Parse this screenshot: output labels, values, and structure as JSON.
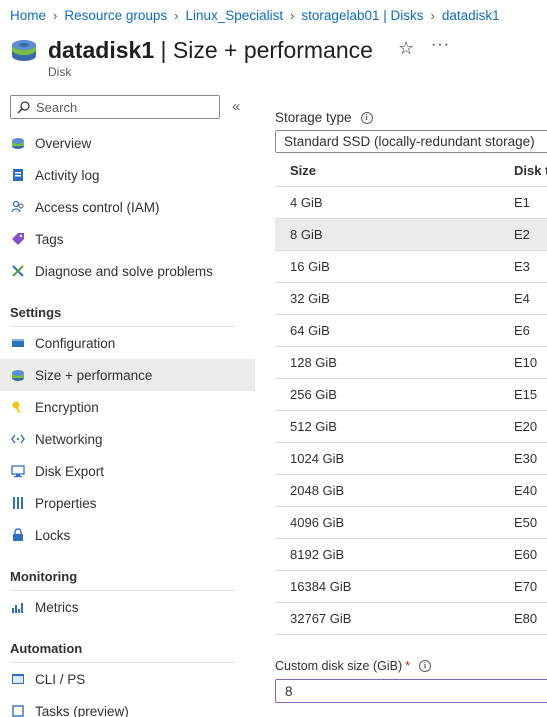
{
  "breadcrumb": [
    "Home",
    "Resource groups",
    "Linux_Specialist",
    "storagelab01 | Disks",
    "datadisk1"
  ],
  "header": {
    "title_bold": "datadisk1",
    "title_rest": " | Size + performance",
    "subtitle": "Disk"
  },
  "sidebar": {
    "search_placeholder": "Search",
    "items_top": [
      {
        "label": "Overview",
        "icon": "overview-icon"
      },
      {
        "label": "Activity log",
        "icon": "activity-log-icon"
      },
      {
        "label": "Access control (IAM)",
        "icon": "iam-icon"
      },
      {
        "label": "Tags",
        "icon": "tag-icon"
      },
      {
        "label": "Diagnose and solve problems",
        "icon": "wrench-icon"
      }
    ],
    "sections": [
      {
        "title": "Settings",
        "items": [
          {
            "label": "Configuration",
            "icon": "configuration-icon"
          },
          {
            "label": "Size + performance",
            "icon": "disk-icon",
            "active": true
          },
          {
            "label": "Encryption",
            "icon": "key-icon"
          },
          {
            "label": "Networking",
            "icon": "networking-icon"
          },
          {
            "label": "Disk Export",
            "icon": "export-icon"
          },
          {
            "label": "Properties",
            "icon": "properties-icon"
          },
          {
            "label": "Locks",
            "icon": "lock-icon"
          }
        ]
      },
      {
        "title": "Monitoring",
        "items": [
          {
            "label": "Metrics",
            "icon": "metrics-icon"
          }
        ]
      },
      {
        "title": "Automation",
        "items": [
          {
            "label": "CLI / PS",
            "icon": "cli-icon"
          },
          {
            "label": "Tasks (preview)",
            "icon": "tasks-icon"
          }
        ]
      }
    ]
  },
  "main": {
    "storage_type_label": "Storage type",
    "storage_type_value": "Standard SSD (locally-redundant storage)",
    "table": {
      "headers": [
        "Size",
        "Disk t"
      ],
      "rows": [
        {
          "size": "4 GiB",
          "tier": "E1"
        },
        {
          "size": "8 GiB",
          "tier": "E2",
          "selected": true
        },
        {
          "size": "16 GiB",
          "tier": "E3"
        },
        {
          "size": "32 GiB",
          "tier": "E4"
        },
        {
          "size": "64 GiB",
          "tier": "E6"
        },
        {
          "size": "128 GiB",
          "tier": "E10"
        },
        {
          "size": "256 GiB",
          "tier": "E15"
        },
        {
          "size": "512 GiB",
          "tier": "E20"
        },
        {
          "size": "1024 GiB",
          "tier": "E30"
        },
        {
          "size": "2048 GiB",
          "tier": "E40"
        },
        {
          "size": "4096 GiB",
          "tier": "E50"
        },
        {
          "size": "8192 GiB",
          "tier": "E60"
        },
        {
          "size": "16384 GiB",
          "tier": "E70"
        },
        {
          "size": "32767 GiB",
          "tier": "E80"
        }
      ]
    },
    "custom_size_label": "Custom disk size (GiB)",
    "custom_size_required": "*",
    "custom_size_value": "8"
  },
  "colors": {
    "link": "#0f6cbd",
    "selected_bg": "#edebe9",
    "focus_border": "#8764b8",
    "required": "#a4262c"
  }
}
